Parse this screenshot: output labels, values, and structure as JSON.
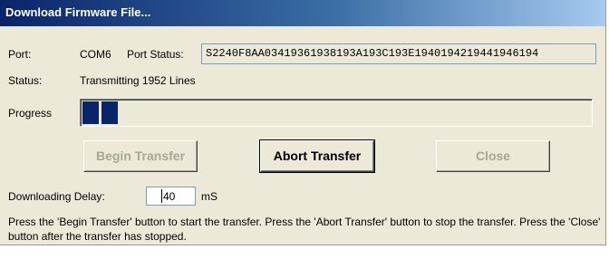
{
  "window": {
    "title": "Download Firmware File..."
  },
  "port": {
    "label": "Port:",
    "value": "COM6",
    "status_label": "Port Status:",
    "status_value": "S2240F8AA03419361938193A193C193E1940194219441946194"
  },
  "status": {
    "label": "Status:",
    "value": "Transmitting 1952 Lines"
  },
  "progress": {
    "label": "Progress",
    "fraction": 0.07
  },
  "buttons": {
    "begin": "Begin Transfer",
    "abort": "Abort Transfer",
    "close": "Close"
  },
  "delay": {
    "label": "Downloading Delay:",
    "value": "40",
    "unit": "mS"
  },
  "instructions": "Press the 'Begin Transfer' button to start the transfer.  Press the 'Abort Transfer' button to stop the transfer.  Press the 'Close' button after the transfer has stopped.",
  "colors": {
    "dialog_background": "#ece9d8",
    "title_bar": "#0a246a",
    "progress_block": "#0a246a",
    "disabled_text": "#a7a697"
  }
}
